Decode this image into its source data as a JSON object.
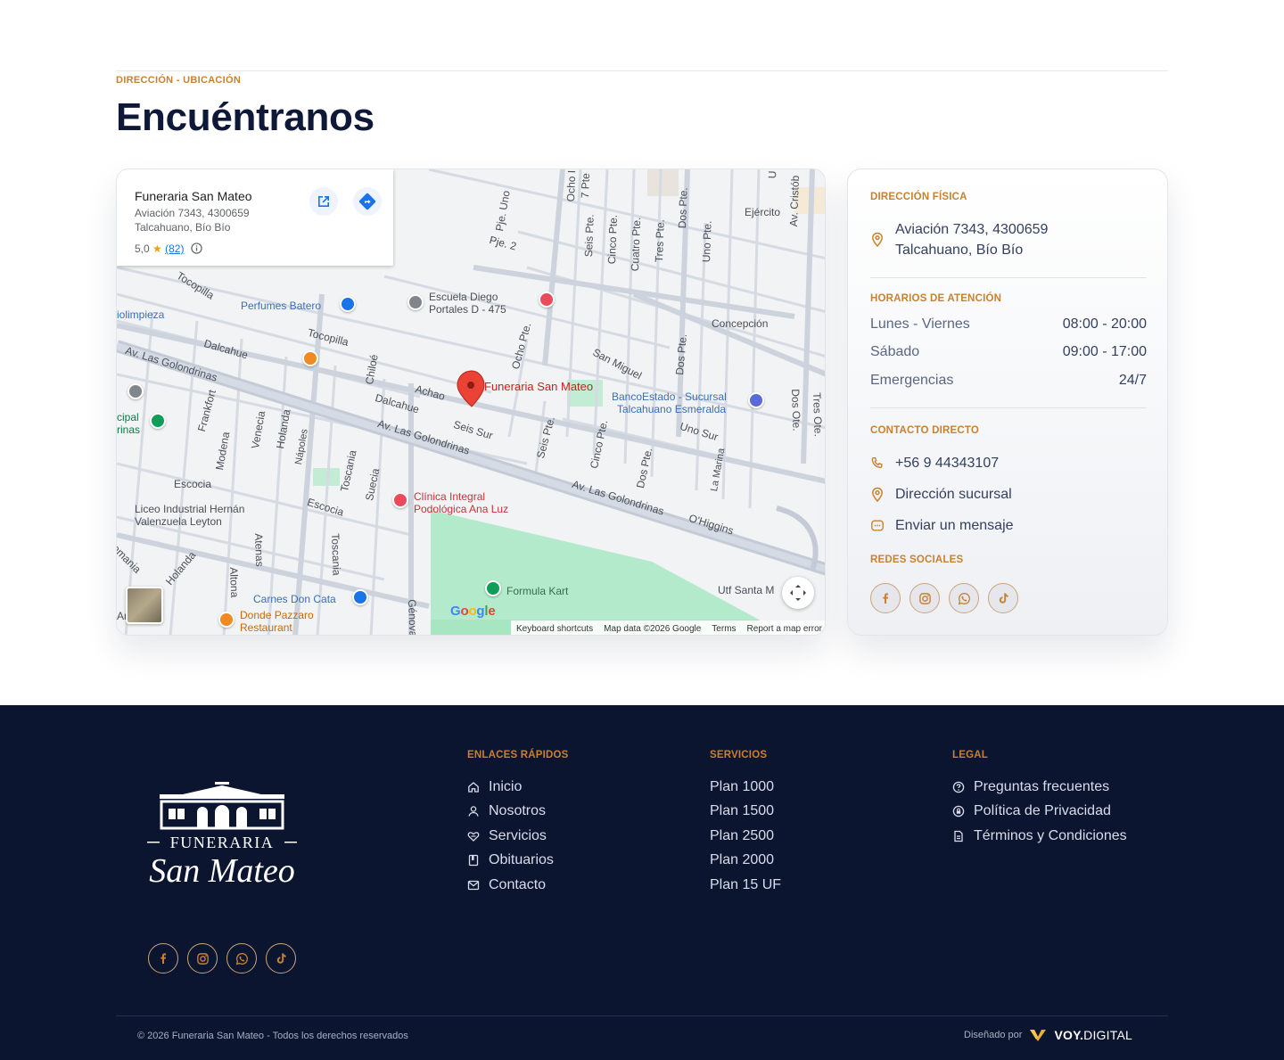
{
  "header": {
    "eyebrow": "DIRECCIÓN - UBICACIÓN",
    "title": "Encuéntranos"
  },
  "map": {
    "card": {
      "name": "Funeraria San Mateo",
      "address_line1": "Aviación 7343, 4300659",
      "address_line2": "Talcahuano, Bío Bío",
      "rating": "5,0",
      "star": "★",
      "reviews": "(82)",
      "open_icon": "open-in-new-icon",
      "directions_icon": "directions-icon"
    },
    "pin_label": "Funeraria San Mateo",
    "labels": {
      "ejercito": "Ejército",
      "concepcion": "Concepción",
      "perfumes": "Perfumes Batero",
      "escuela1": "Escuela Diego",
      "escuela2": "Portales D - 475",
      "tocopilla1": "Tocopilla",
      "tocopilla2": "Tocopilla",
      "dalcahue1": "Dalcahue",
      "dalcahue2": "Dalcahue",
      "achao": "Achao",
      "golondrinas1": "Av. Las Golondrinas",
      "golondrinas2": "Av. Las Golondrinas",
      "golondrinas3": "Av. Las Golondrinas",
      "seis_sur": "Seis Sur",
      "uno_sur": "Uno Sur",
      "san_miguel": "San Miguel",
      "banco1": "BancoEstado - Sucursal",
      "banco2": "Talcahuano Esmeralda",
      "ohiggins": "O'Higgins",
      "escocia1": "Escocia",
      "escocia2": "Escocia",
      "liceo1": "Liceo Industrial Hernán",
      "liceo2": "Valenzuela Leyton",
      "clinica1": "Clínica Integral",
      "clinica2": "Podológica Ana Luz",
      "carnes": "Carnes Don Cata",
      "donde1": "Donde Pazzaro",
      "donde2": "Restaurant",
      "formula": "Formula Kart",
      "utf": "Utf Santa M",
      "limpieza": "iolimpieza",
      "cipal": "cipal",
      "rinas": "rinas",
      "pje_uno": "Pje. Uno",
      "pje_2": "Pje. 2",
      "ocho_pte": "Ocho Pte.",
      "seis_pte": "Seis Pte.",
      "seis_pte2": "Seis Pte.",
      "cinco_pte": "Cinco Pte.",
      "cinco_pte2": "Cinco Pte.",
      "cuatro_pte": "Cuatro Pte.",
      "tres_pte": "Tres Pte.",
      "dos_pte": "Dos Pte.",
      "dos_pte2": "Dos Pte.",
      "dos_pte3": "Dos Pte.",
      "uno_pte": "Uno Pte.",
      "av_cristob": "Av. Cristób",
      "dos_ote": "Dos Ote.",
      "tres_ote": "Tres Ote.",
      "siete_pte": "7 Pte",
      "ocho_t": "Ocho I",
      "frankfort": "Frankfort",
      "modena": "Modena",
      "venecia": "Venecia",
      "holanda": "Holanda",
      "holanda2": "Holanda",
      "napoles": "Nápoles",
      "chiloe": "Chiloé",
      "toscania": "Toscania",
      "toscania2": "Toscania",
      "suecia": "Suecia",
      "atenas": "Atenas",
      "altona": "Altona",
      "genova": "Génova",
      "la_marina": "La Marina",
      "alemania": "emania",
      "ar": "Ar",
      "u_top": "U"
    },
    "google": "Google",
    "attribution": {
      "shortcuts": "Keyboard shortcuts",
      "data": "Map data ©2026 Google",
      "terms": "Terms",
      "report": "Report a map error"
    }
  },
  "info": {
    "address_heading": "DIRECCIÓN FÍSICA",
    "address_line1": "Aviación 7343, 4300659",
    "address_line2": "Talcahuano, Bío Bío",
    "hours_heading": "HORARIOS DE ATENCIÓN",
    "hours": [
      {
        "day": "Lunes - Viernes",
        "time": "08:00 - 20:00"
      },
      {
        "day": "Sábado",
        "time": "09:00 - 17:00"
      },
      {
        "day": "Emergencias",
        "time": "24/7"
      }
    ],
    "contact_heading": "CONTACTO DIRECTO",
    "phone": "+56 9 44343107",
    "branch": "Dirección sucursal",
    "message": "Enviar un mensaje",
    "social_heading": "REDES SOCIALES",
    "socials": [
      "facebook-icon",
      "instagram-icon",
      "whatsapp-icon",
      "tiktok-icon"
    ]
  },
  "footer": {
    "logo_text_top": "FUNERARIA",
    "logo_text_bottom": "San Mateo",
    "quick_heading": "ENLACES RÁPIDOS",
    "quick_links": [
      "Inicio",
      "Nosotros",
      "Servicios",
      "Obituarios",
      "Contacto"
    ],
    "services_heading": "SERVICIOS",
    "services": [
      "Plan 1000",
      "Plan 1500",
      "Plan 2500",
      "Plan 2000",
      "Plan 15 UF"
    ],
    "legal_heading": "LEGAL",
    "legal": [
      "Preguntas frecuentes",
      "Política de Privacidad",
      "Términos y Condiciones"
    ],
    "copyright": "© 2026 Funeraria San Mateo - Todos los derechos reservados",
    "designed_by": "Diseñado por",
    "brand_bold": "VOY.",
    "brand_rest": "DIGITAL"
  },
  "colors": {
    "accent": "#c8812f",
    "navy": "#0c1530",
    "title": "#0e1838",
    "park": "#a8e6c1",
    "pin": "#ea4335"
  }
}
